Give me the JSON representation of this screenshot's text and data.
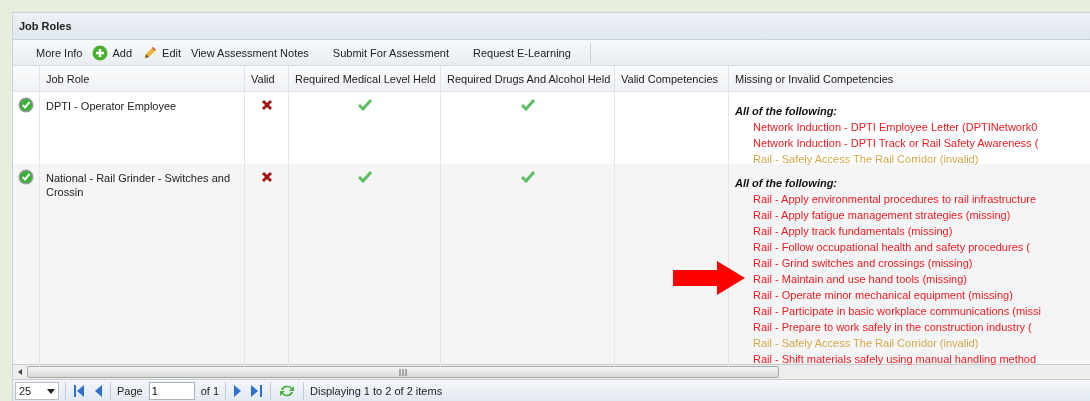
{
  "panel": {
    "title": "Job Roles"
  },
  "toolbar": [
    {
      "label": "More Info",
      "kind": "plain"
    },
    {
      "label": "Add",
      "kind": "add"
    },
    {
      "label": "Edit",
      "kind": "edit"
    },
    {
      "label": "View Assessment Notes",
      "kind": "plain"
    },
    {
      "label": "Submit For Assessment",
      "kind": "plain"
    },
    {
      "label": "Request E-Learning",
      "kind": "plain"
    }
  ],
  "table": {
    "columns": [
      "Job Role",
      "Valid",
      "Required Medical Level Held",
      "Required Drugs And Alcohol Held",
      "Valid Competencies",
      "Missing or Invalid Competencies"
    ],
    "rows": [
      {
        "status_ok": true,
        "job_role": "DPTI - Operator Employee",
        "valid": false,
        "medical_held": true,
        "drugs_alcohol_held": true,
        "missing_heading": "All of the following:",
        "missing": [
          {
            "text": "Network Induction - DPTI Employee Letter (DPTINetwork0",
            "kind": "missing"
          },
          {
            "text": "Network Induction - DPTI Track or Rail Safety Awareness (",
            "kind": "missing"
          },
          {
            "text": "Rail - Safely Access The Rail Corridor (invalid)",
            "kind": "invalid"
          }
        ]
      },
      {
        "status_ok": true,
        "job_role": "National - Rail Grinder - Switches and Crossin",
        "valid": false,
        "medical_held": true,
        "drugs_alcohol_held": true,
        "missing_heading": "All of the following:",
        "missing": [
          {
            "text": "Rail - Apply environmental procedures to rail infrastructure",
            "kind": "missing"
          },
          {
            "text": "Rail - Apply fatigue management strategies (missing)",
            "kind": "missing"
          },
          {
            "text": "Rail - Apply track fundamentals (missing)",
            "kind": "missing"
          },
          {
            "text": "Rail - Follow occupational health and safety procedures (",
            "kind": "missing"
          },
          {
            "text": "Rail - Grind switches and crossings (missing)",
            "kind": "missing"
          },
          {
            "text": "Rail - Maintain and use hand tools (missing)",
            "kind": "missing"
          },
          {
            "text": "Rail - Operate minor mechanical equipment (missing)",
            "kind": "missing"
          },
          {
            "text": "Rail - Participate in basic workplace communications (missi",
            "kind": "missing"
          },
          {
            "text": "Rail - Prepare to work safely in the construction industry (",
            "kind": "missing"
          },
          {
            "text": "Rail - Safely Access The Rail Corridor (invalid)",
            "kind": "invalid"
          },
          {
            "text": "Rail - Shift materials safely using manual handling method",
            "kind": "missing"
          }
        ]
      }
    ]
  },
  "pager": {
    "page_size": "25",
    "page_label": "Page",
    "page": "1",
    "of_label": "of 1",
    "summary": "Displaying 1 to 2 of 2 items"
  }
}
